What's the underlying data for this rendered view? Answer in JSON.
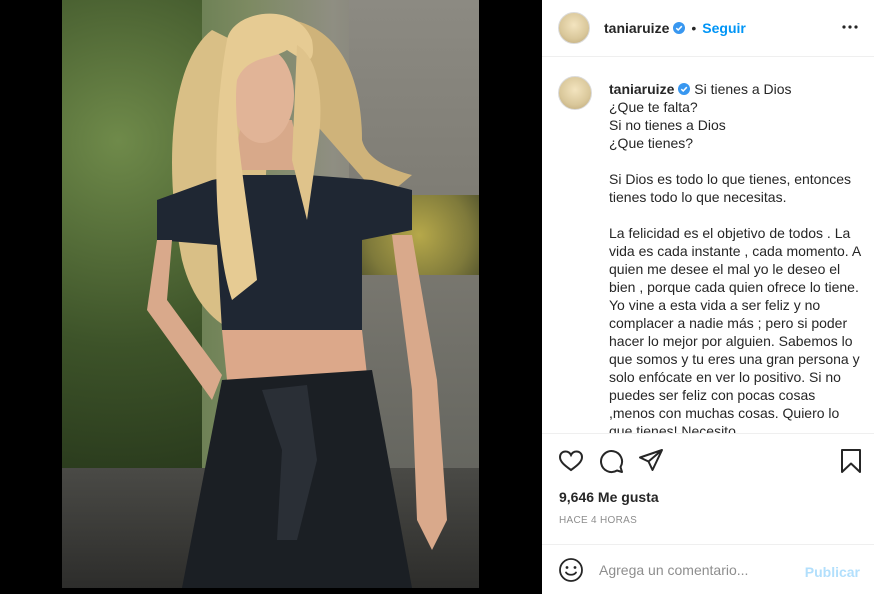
{
  "post": {
    "username": "taniaruize",
    "follow_label": "Seguir",
    "separator": "•",
    "caption_username": "taniaruize",
    "caption_text": " Si tienes a Dios\n¿Que te falta?\nSi no tienes a Dios\n¿Que tienes?\n\nSi Dios es todo lo que tienes, entonces tienes todo lo que necesitas.\n\nLa felicidad es el objetivo de todos . La vida es cada instante , cada momento. A quien me desee el mal yo le deseo el bien , porque cada quien ofrece lo tiene. Yo vine a esta vida a ser feliz y no complacer a nadie más ; pero si poder hacer lo mejor por alguien. Sabemos lo que somos y tu eres una gran persona y solo enfócate en ver lo positivo. Si no puedes ser feliz con pocas cosas ,menos con muchas cosas. Quiero lo que tienes! Necesito",
    "likes": "9,646 Me gusta",
    "time": "HACE 4 HORAS"
  },
  "comment": {
    "placeholder": "Agrega un comentario...",
    "publish_label": "Publicar"
  },
  "colors": {
    "accent": "#0095f6",
    "publish_disabled": "#b2dffc",
    "verified": "#3897f0"
  },
  "icons": [
    "verified-badge-icon",
    "more-options-icon",
    "heart-icon",
    "comment-icon",
    "share-icon",
    "bookmark-icon",
    "emoji-icon"
  ]
}
